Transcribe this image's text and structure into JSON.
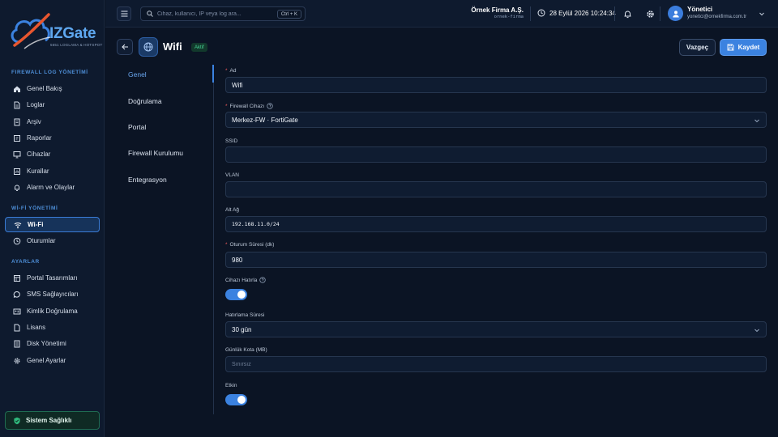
{
  "brand": {
    "name": "IZGate",
    "tagline": "5651 LOGLAMA & HOTSPOT"
  },
  "sidebar": {
    "sections": [
      {
        "title": "FIREWALL LOG YÖNETİMİ"
      },
      {
        "title": "Wİ-Fİ YÖNETİMİ"
      },
      {
        "title": "AYARLAR"
      }
    ],
    "items": [
      {
        "label": "Genel Bakış",
        "icon": "home-icon"
      },
      {
        "label": "Loglar",
        "icon": "file-icon"
      },
      {
        "label": "Arşiv",
        "icon": "archive-icon"
      },
      {
        "label": "Raporlar",
        "icon": "report-icon"
      },
      {
        "label": "Cihazlar",
        "icon": "monitor-icon"
      },
      {
        "label": "Kurallar",
        "icon": "rules-icon"
      },
      {
        "label": "Alarm ve Olaylar",
        "icon": "bell-icon"
      },
      {
        "label": "Wi-Fi",
        "icon": "wifi-icon",
        "active": true
      },
      {
        "label": "Oturumlar",
        "icon": "clock-icon"
      },
      {
        "label": "Portal Tasarımları",
        "icon": "layout-icon"
      },
      {
        "label": "SMS Sağlayıcıları",
        "icon": "message-icon"
      },
      {
        "label": "Kimlik Doğrulama",
        "icon": "id-card-icon"
      },
      {
        "label": "Lisans",
        "icon": "license-icon"
      },
      {
        "label": "Disk Yönetimi",
        "icon": "disk-icon"
      },
      {
        "label": "Genel Ayarlar",
        "icon": "gear-icon"
      }
    ],
    "health_label": "Sistem Sağlıklı"
  },
  "topbar": {
    "search_placeholder": "Cihaz, kullanıcı, IP veya log ara...",
    "search_shortcut": "Ctrl + K",
    "company_name": "Örnek Firma A.Ş.",
    "company_code": "ornek-firma",
    "datetime": "28 Eylül 2026 10:24:34",
    "user_name": "Yönetici",
    "user_email": "yonetici@ornekfirma.com.tr"
  },
  "page": {
    "title": "Wifi",
    "status_badge": "Aktif",
    "cancel_label": "Vazgeç",
    "save_label": "Kaydet"
  },
  "tabs": [
    "Genel",
    "Doğrulama",
    "Portal",
    "Firewall Kurulumu",
    "Entegrasyon"
  ],
  "form": {
    "name_label": "Ad",
    "name_value": "Wifi",
    "firewall_label": "Firewall Cihazı",
    "firewall_value": "Merkez-FW · FortiGate",
    "ssid_label": "SSID",
    "ssid_value": "",
    "vlan_label": "VLAN",
    "vlan_value": "",
    "subnet_label": "Alt Ağ",
    "subnet_value": "192.168.11.0/24",
    "session_label": "Oturum Süresi (dk)",
    "session_value": "980",
    "remember_label": "Cihazı Hatırla",
    "remember_on": true,
    "remember_duration_label": "Hatırlama Süresi",
    "remember_duration_value": "30 gün",
    "quota_label": "Günlük Kota (MB)",
    "quota_placeholder": "Sınırsız",
    "enabled_label": "Etkin",
    "enabled_on": true
  },
  "colors": {
    "accent": "#3b82e0",
    "background": "#0b1424",
    "success": "#48d597",
    "required": "#f05a5a"
  }
}
